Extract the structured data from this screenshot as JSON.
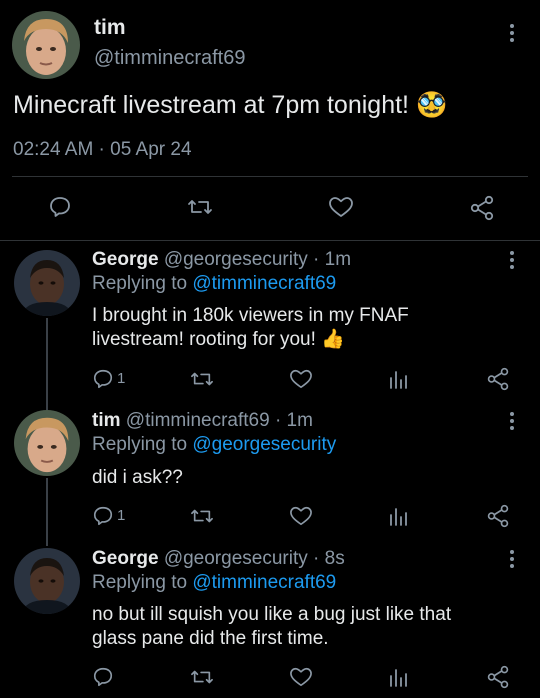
{
  "main_tweet": {
    "display_name": "tim",
    "handle": "@timminecraft69",
    "text": "Minecraft livestream at 7pm tonight!",
    "emoji": "🥸",
    "timestamp": "02:24 AM · 05 Apr 24"
  },
  "replies": [
    {
      "display_name": "George",
      "handle": "@georgesecurity",
      "time": "· 1m",
      "replying_prefix": "Replying to",
      "replying_to": "@timminecraft69",
      "text": "I brought in 180k viewers in my FNAF livestream! rooting for you!",
      "emoji": "👍",
      "reply_count": "1"
    },
    {
      "display_name": "tim",
      "handle": "@timminecraft69",
      "time": "· 1m",
      "replying_prefix": "Replying to",
      "replying_to": "@georgesecurity",
      "text": "did i ask??",
      "reply_count": "1"
    },
    {
      "display_name": "George",
      "handle": "@georgesecurity",
      "time": "· 8s",
      "replying_prefix": "Replying to",
      "replying_to": "@timminecraft69",
      "text": "no but ill squish you like a bug just like that glass pane did the first time.",
      "reply_count": ""
    }
  ],
  "icons": [
    "reply-icon",
    "retweet-icon",
    "like-icon",
    "views-icon",
    "share-icon",
    "more-icon"
  ],
  "colors": {
    "background": "#000000",
    "link": "#1d9bf0",
    "muted": "#8b98a5"
  }
}
